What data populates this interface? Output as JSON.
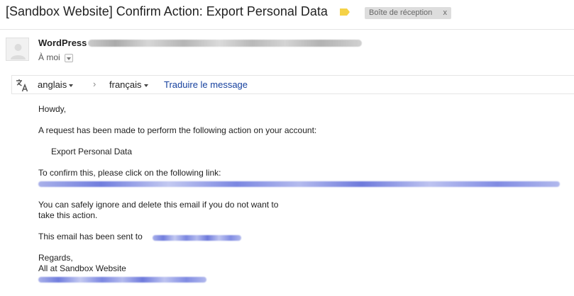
{
  "header": {
    "subject": "[Sandbox Website] Confirm Action: Export Personal Data",
    "label": {
      "text": "Boîte de réception",
      "close": "x"
    }
  },
  "message": {
    "sender": "WordPress",
    "recipient": "À moi"
  },
  "translation": {
    "source_language": "anglais",
    "separator": "›",
    "target_language": "français",
    "translate_link": "Traduire le message"
  },
  "body": {
    "greeting": "Howdy,",
    "intro": "A request has been made to perform the following action on your account:",
    "action": "Export Personal Data",
    "confirm": "To confirm this, please click on the following link:",
    "ignore_line1": "You can safely ignore and delete this email if you do not want to",
    "ignore_line2": "take this action.",
    "sent_to": "This email has been sent to",
    "regards": "Regards,",
    "signature": "All at Sandbox Website"
  },
  "colors": {
    "important_marker": "#f5d247",
    "link": "#15409e",
    "label_chip_bg": "#dddddd"
  },
  "icons": {
    "important": "important-marker-icon",
    "avatar": "person-icon",
    "recipient_details": "chevron-down-icon",
    "translate": "translate-icon"
  }
}
